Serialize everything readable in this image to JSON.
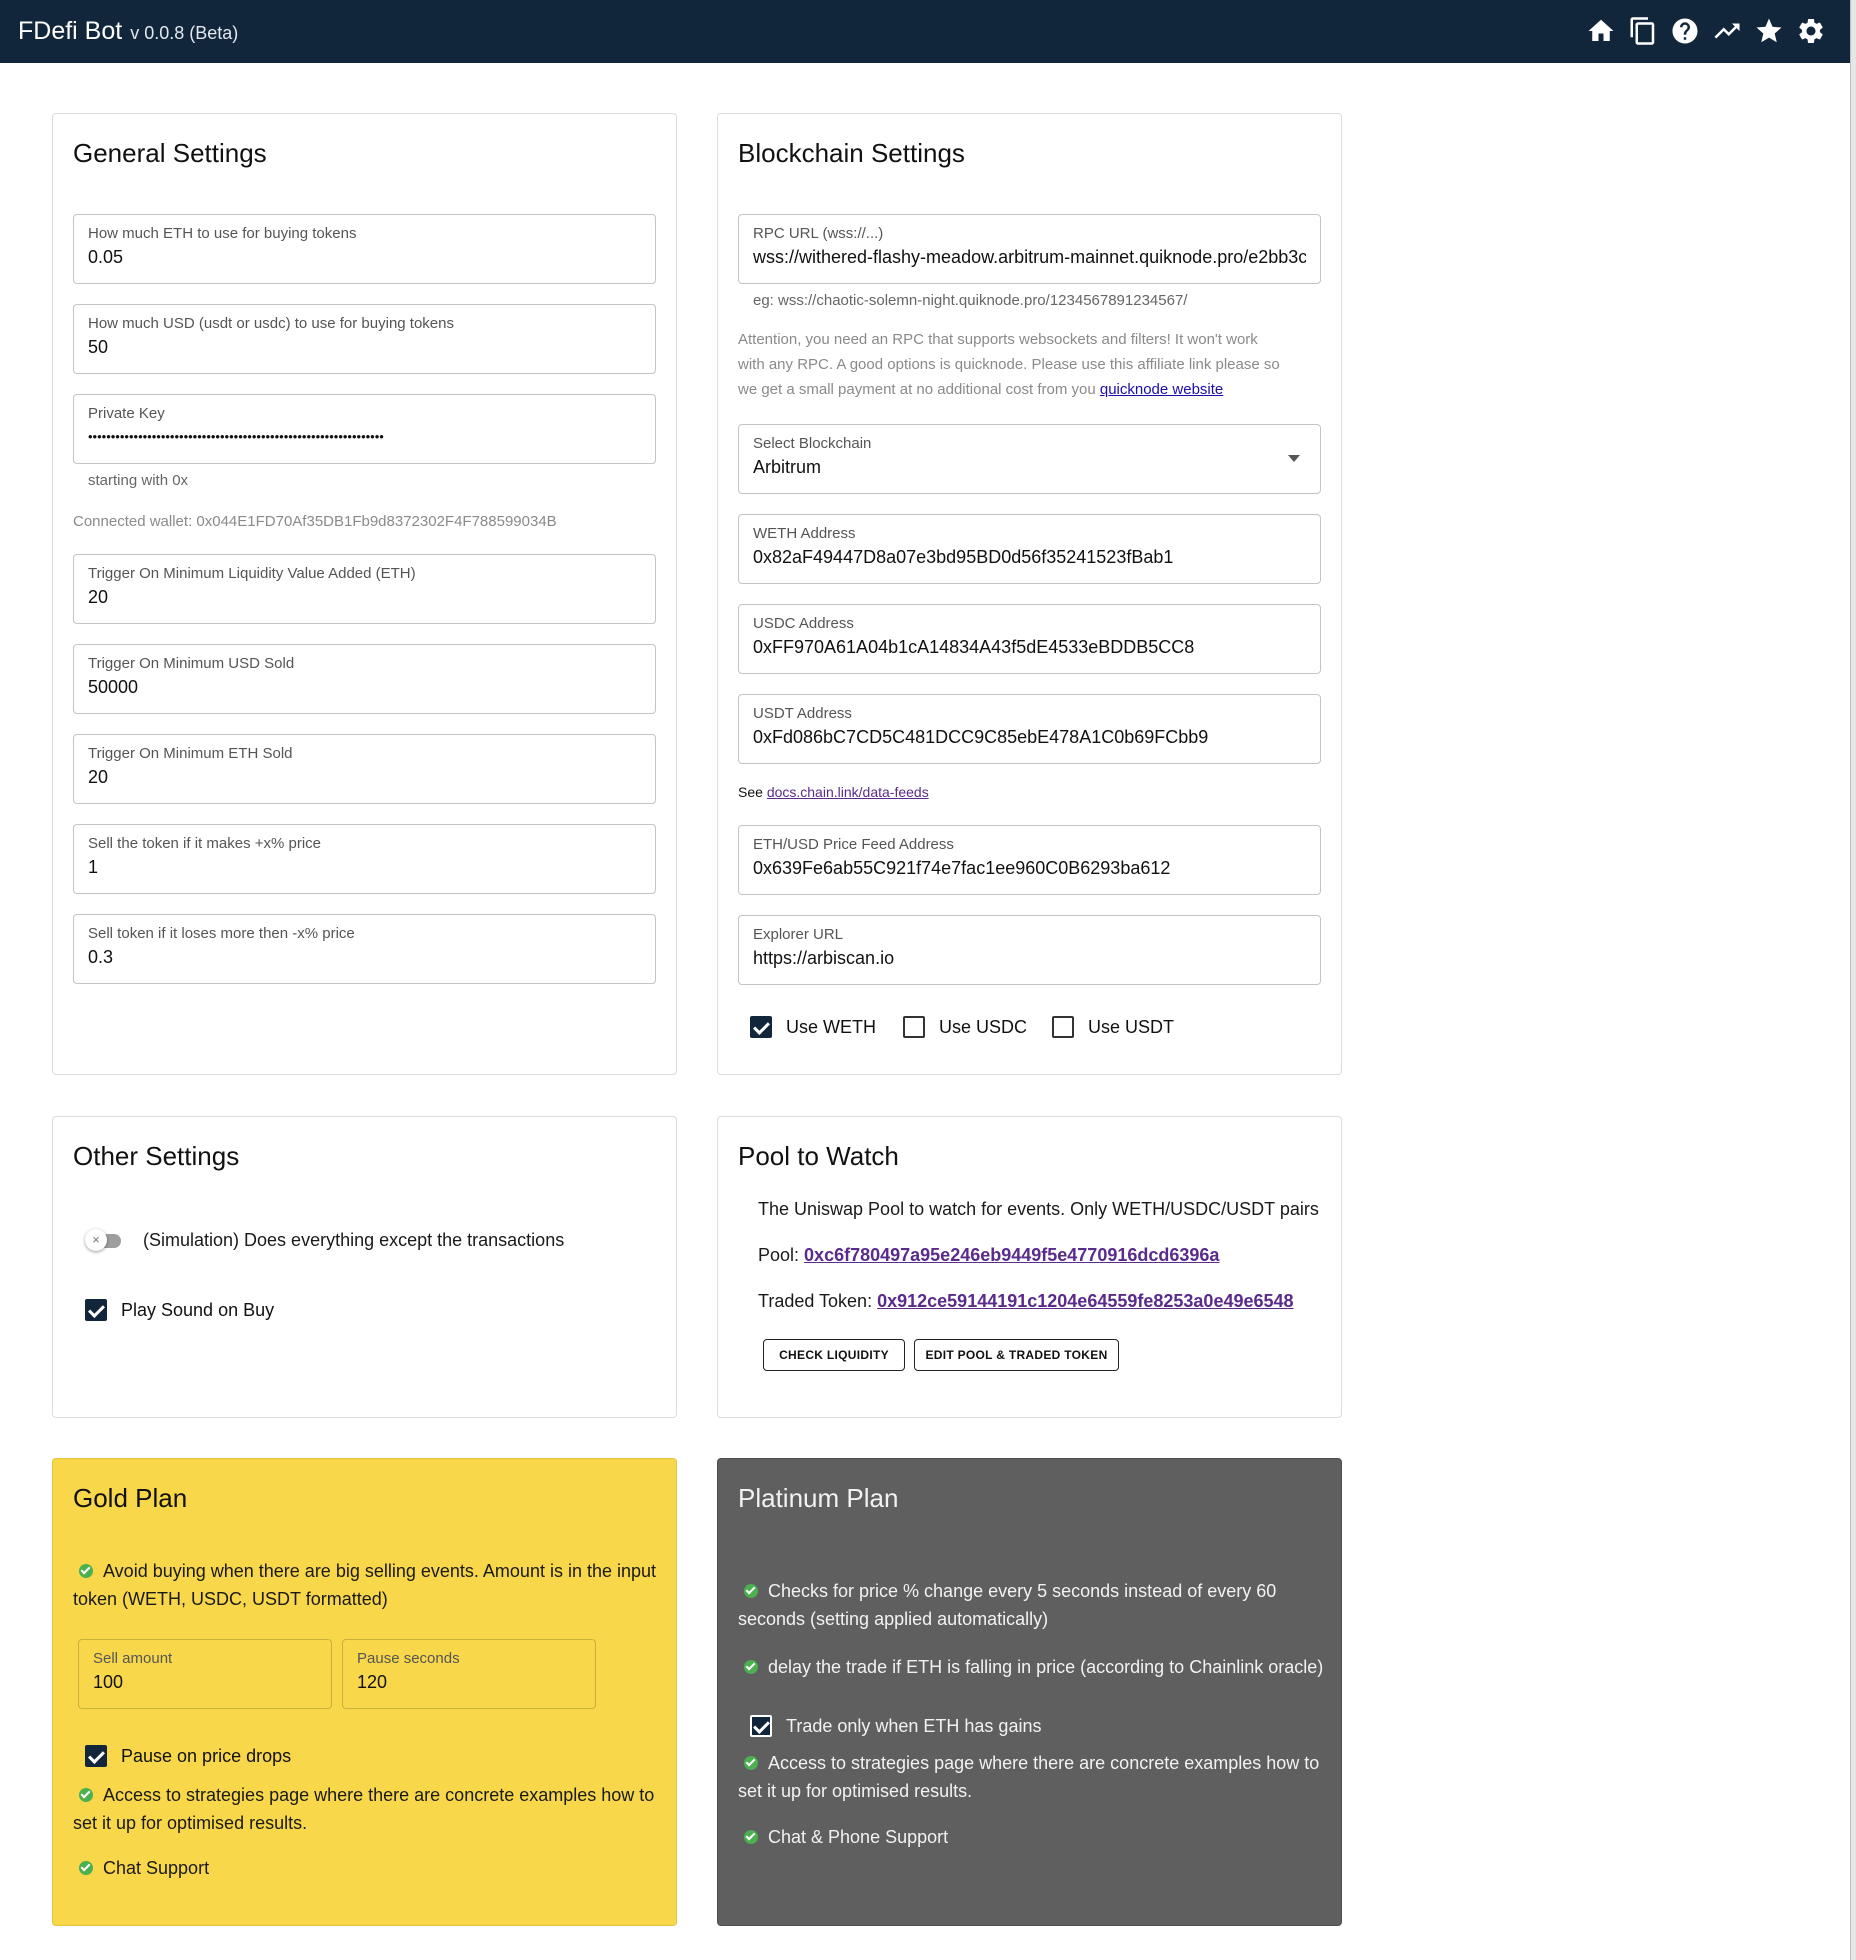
{
  "app": {
    "title": "FDefi Bot",
    "version": "v 0.0.8 (Beta)"
  },
  "toolbar_icons": [
    "home-icon",
    "copy-icon",
    "help-icon",
    "trending-up-icon",
    "star-icon",
    "settings-icon"
  ],
  "general": {
    "title": "General Settings",
    "eth_amount": {
      "label": "How much ETH to use for buying tokens",
      "value": "0.05"
    },
    "usd_amount": {
      "label": "How much USD (usdt or usdc) to use for buying tokens",
      "value": "50"
    },
    "private_key": {
      "label": "Private Key",
      "value": "•••••••••••••••••••••••••••••••••••••••••••••••••••••••••••••••••",
      "helper": "starting with 0x"
    },
    "wallet": "Connected wallet: 0x044E1FD70Af35DB1Fb9d8372302F4F788599034B",
    "min_liquidity": {
      "label": "Trigger On Minimum Liquidity Value Added (ETH)",
      "value": "20"
    },
    "min_usd_sold": {
      "label": "Trigger On Minimum USD Sold",
      "value": "50000"
    },
    "min_eth_sold": {
      "label": "Trigger On Minimum ETH Sold",
      "value": "20"
    },
    "take_profit": {
      "label": "Sell the token if it makes +x% price",
      "value": "1"
    },
    "stop_loss": {
      "label": "Sell token if it loses more then -x% price",
      "value": "0.3"
    }
  },
  "blockchain": {
    "title": "Blockchain Settings",
    "rpc": {
      "label": "RPC URL (wss://...)",
      "value": "wss://withered-flashy-meadow.arbitrum-mainnet.quiknode.pro/e2bb3c",
      "helper": "eg: wss://chaotic-solemn-night.quiknode.pro/1234567891234567/"
    },
    "attention_1": "Attention, you need an RPC that supports websockets and filters! It won't work",
    "attention_2": "with any RPC. A good options is quicknode. Please use this affiliate link please so",
    "attention_3": "we get a small payment at no additional cost from you",
    "quicknode_link": "quicknode website",
    "chain": {
      "label": "Select Blockchain",
      "value": "Arbitrum"
    },
    "weth": {
      "label": "WETH Address",
      "value": "0x82aF49447D8a07e3bd95BD0d56f35241523fBab1"
    },
    "usdc": {
      "label": "USDC Address",
      "value": "0xFF970A61A04b1cA14834A43f5dE4533eBDDB5CC8"
    },
    "usdt": {
      "label": "USDT Address",
      "value": "0xFd086bC7CD5C481DCC9C85ebE478A1C0b69FCbb9"
    },
    "see_label": "See",
    "see_link": "docs.chain.link/data-feeds",
    "price_feed": {
      "label": "ETH/USD Price Feed Address",
      "value": "0x639Fe6ab55C921f74e7fac1ee960C0B6293ba612"
    },
    "explorer": {
      "label": "Explorer URL",
      "value": "https://arbiscan.io"
    },
    "use_weth": "Use WETH",
    "use_usdc": "Use USDC",
    "use_usdt": "Use USDT"
  },
  "other": {
    "title": "Other Settings",
    "simulation": "(Simulation) Does everything except the transactions",
    "play_sound": "Play Sound on Buy"
  },
  "pool": {
    "title": "Pool to Watch",
    "description": "The Uniswap Pool to watch for events. Only WETH/USDC/USDT pairs",
    "pool_label": "Pool:",
    "pool_address": "0xc6f780497a95e246eb9449f5e4770916dcd6396a",
    "token_label": "Traded Token:",
    "token_address": "0x912ce59144191c1204e64559fe8253a0e49e6548",
    "check_btn": "CHECK LIQUIDITY",
    "edit_btn": "EDIT POOL & TRADED TOKEN"
  },
  "gold": {
    "title": "Gold Plan",
    "feat1": "Avoid buying when there are big selling events. Amount is in the input",
    "feat1b": "token (WETH, USDC, USDT formatted)",
    "sell_amount": {
      "label": "Sell amount",
      "value": "100"
    },
    "pause_seconds": {
      "label": "Pause seconds",
      "value": "120"
    },
    "pause_drops": "Pause on price drops",
    "feat2": "Access to strategies page where there are concrete examples how to",
    "feat2b": "set it up for optimised results.",
    "feat3": "Chat Support"
  },
  "platinum": {
    "title": "Platinum Plan",
    "feat1": "Checks for price % change every 5 seconds instead of every 60",
    "feat1b": "seconds (setting applied automatically)",
    "feat2": "delay the trade if ETH is falling in price (according to Chainlink oracle)",
    "trade_gains": "Trade only when ETH has gains",
    "feat3": "Access to strategies page where there are concrete examples how to",
    "feat3b": "set it up for optimised results.",
    "feat4": "Chat & Phone Support"
  }
}
